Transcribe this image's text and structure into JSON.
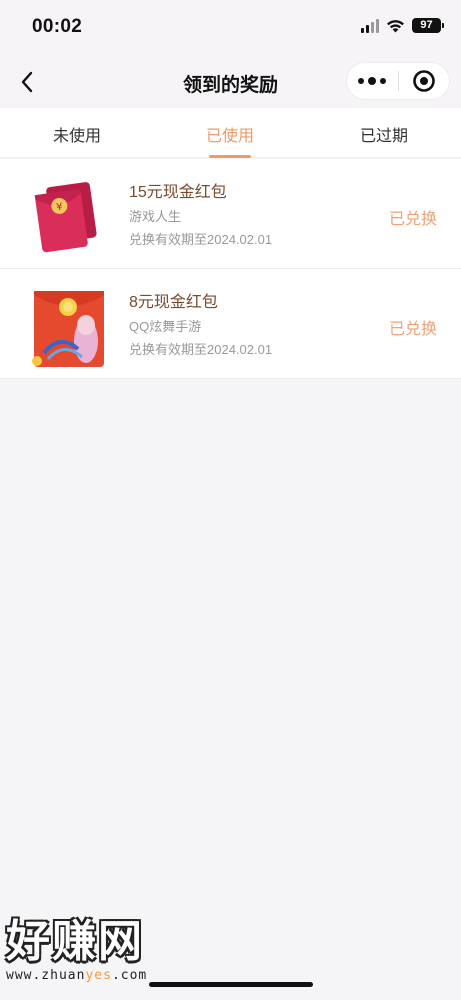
{
  "status_bar": {
    "time": "00:02",
    "battery": "97",
    "icons": [
      "signal-icon",
      "wifi-icon",
      "battery-icon"
    ]
  },
  "nav": {
    "title": "领到的奖励",
    "back_icon": "chevron-left-icon",
    "more_icon": "more-dots-icon",
    "close_icon": "target-circle-icon"
  },
  "tabs": [
    {
      "label": "未使用",
      "active": false
    },
    {
      "label": "已使用",
      "active": true
    },
    {
      "label": "已过期",
      "active": false
    }
  ],
  "rewards": [
    {
      "title": "15元现金红包",
      "source": "游戏人生",
      "expiry": "兑换有效期至2024.02.01",
      "status": "已兑换",
      "thumb_icon": "red-envelope-icon"
    },
    {
      "title": "8元现金红包",
      "source": "QQ炫舞手游",
      "expiry": "兑换有效期至2024.02.01",
      "status": "已兑换",
      "thumb_icon": "game-red-envelope-icon"
    }
  ],
  "watermark": {
    "big": "好赚网",
    "small_prefix": "www.zhuan",
    "small_accent": "yes",
    "small_suffix": ".com"
  },
  "colors": {
    "accent": "#ee9a6a",
    "status": "#f0a277",
    "title": "#7a4a2c",
    "background": "#f5f4f6"
  }
}
